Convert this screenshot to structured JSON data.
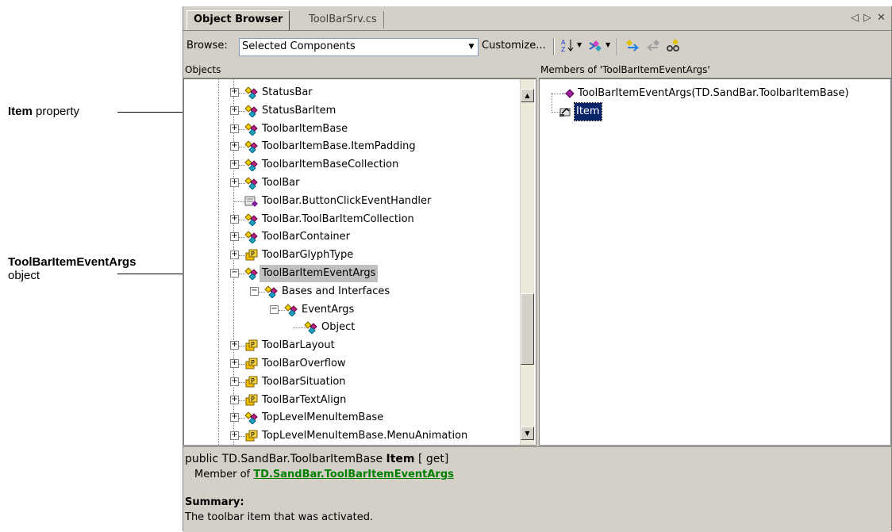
{
  "callouts": {
    "item": {
      "bold": "Item",
      "rest": " property"
    },
    "eventargs": {
      "bold": "ToolBarItemEventArgs",
      "rest": "object"
    }
  },
  "tabs": {
    "active": "Object Browser",
    "inactive": "ToolBarSrv.cs",
    "controls": [
      "◁",
      "▷",
      "✕"
    ]
  },
  "toolbar": {
    "browse_label": "Browse:",
    "browse_value": "Selected Components",
    "customize_label": "Customize...",
    "icons": [
      "sort-alpha-icon",
      "filter-members-icon",
      "go-back-icon",
      "go-forward-icon",
      "find-symbol-icon"
    ]
  },
  "objects_pane": {
    "header": "Objects",
    "items": [
      {
        "label": "StatusBar",
        "icon": "class-icon",
        "expander": "+"
      },
      {
        "label": "StatusBarItem",
        "icon": "class-icon",
        "expander": "+"
      },
      {
        "label": "ToolbarItemBase",
        "icon": "class-icon",
        "expander": "+"
      },
      {
        "label": "ToolbarItemBase.ItemPadding",
        "icon": "class-icon",
        "expander": "+"
      },
      {
        "label": "ToolbarItemBaseCollection",
        "icon": "class-icon",
        "expander": "+"
      },
      {
        "label": "ToolBar",
        "icon": "class-icon",
        "expander": "+"
      },
      {
        "label": "ToolBar.ButtonClickEventHandler",
        "icon": "delegate-icon",
        "expander": ""
      },
      {
        "label": "ToolBar.ToolBarItemCollection",
        "icon": "class-icon",
        "expander": "+"
      },
      {
        "label": "ToolBarContainer",
        "icon": "class-icon",
        "expander": "+"
      },
      {
        "label": "ToolBarGlyphType",
        "icon": "enum-icon",
        "expander": "+"
      },
      {
        "label": "ToolBarItemEventArgs",
        "icon": "class-icon",
        "expander": "−"
      },
      {
        "label": "Bases and Interfaces",
        "icon": "class-icon",
        "expander": "−"
      },
      {
        "label": "EventArgs",
        "icon": "class-icon",
        "expander": "−"
      },
      {
        "label": "Object",
        "icon": "class-icon",
        "expander": ""
      },
      {
        "label": "ToolBarLayout",
        "icon": "enum-icon",
        "expander": "+"
      },
      {
        "label": "ToolBarOverflow",
        "icon": "enum-icon",
        "expander": "+"
      },
      {
        "label": "ToolBarSituation",
        "icon": "enum-icon",
        "expander": "+"
      },
      {
        "label": "ToolBarTextAlign",
        "icon": "enum-icon",
        "expander": "+"
      },
      {
        "label": "TopLevelMenuItemBase",
        "icon": "class-icon",
        "expander": "+"
      },
      {
        "label": "TopLevelMenuItemBase.MenuAnimation",
        "icon": "enum-icon",
        "expander": "+"
      }
    ]
  },
  "members_pane": {
    "header": "Members of 'ToolBarItemEventArgs'",
    "items": [
      {
        "label": "ToolBarItemEventArgs(TD.SandBar.ToolbarItemBase)",
        "icon": "method-icon"
      },
      {
        "label": "Item",
        "icon": "property-icon"
      }
    ]
  },
  "description": {
    "signature_prefix": "public TD.SandBar.ToolbarItemBase ",
    "signature_name": "Item",
    "signature_suffix": " [  get]",
    "member_of_label": "Member of ",
    "member_of_link": "TD.SandBar.ToolBarItemEventArgs",
    "summary_label": "Summary:",
    "summary_text": "The toolbar item that was activated."
  },
  "colors": {
    "chrome": "#d4d0c8",
    "selection": "#0a246a",
    "link": "#008000",
    "tree_selection": "#c0c0c0"
  }
}
